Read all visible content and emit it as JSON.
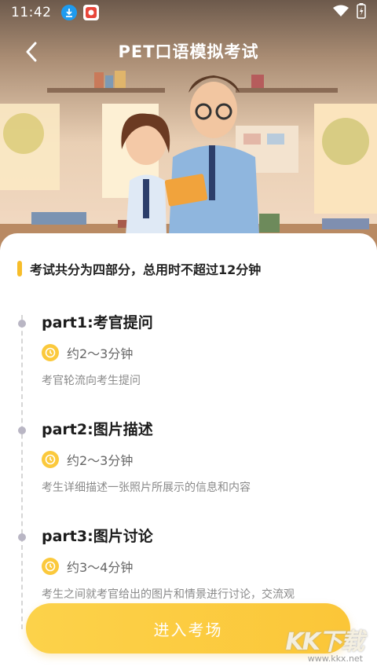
{
  "status_bar": {
    "time": "11:42"
  },
  "header": {
    "title": "PET口语模拟考试"
  },
  "summary": "考试共分为四部分，总用时不超过12分钟",
  "parts": [
    {
      "title": "part1:考官提问",
      "duration": "约2～3分钟",
      "description": "考官轮流向考生提问"
    },
    {
      "title": "part2:图片描述",
      "duration": "约2～3分钟",
      "description": "考生详细描述一张照片所展示的信息和内容"
    },
    {
      "title": "part3:图片讨论",
      "duration": "约3～4分钟",
      "description": "考生之间就考官给出的图片和情景进行讨论，交流观"
    }
  ],
  "enter_button": {
    "label": "进入考场"
  },
  "watermark": {
    "logo": "KK下载",
    "url": "www.kkx.net"
  },
  "colors": {
    "accent": "#FBC93C",
    "button": "#FCD24A"
  }
}
